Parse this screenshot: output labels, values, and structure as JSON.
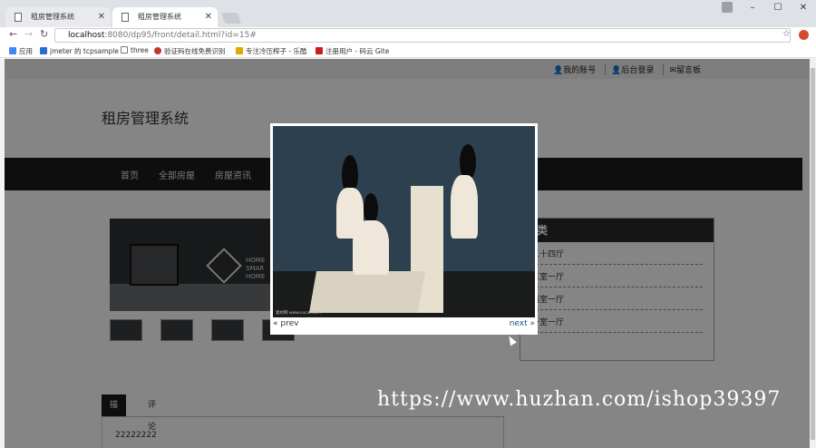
{
  "browser": {
    "tabs": [
      {
        "label": "租房管理系统"
      },
      {
        "label": "租房管理系统"
      }
    ],
    "address": {
      "host": "localhost",
      "rest": ":8080/dp95/front/detail.html?id=15#"
    },
    "bookmarks": [
      {
        "label": "应用",
        "color": "#4285f4"
      },
      {
        "label": "jmeter 的 tcpsample",
        "color": "#2a6dd2"
      },
      {
        "label": "three",
        "color": "#777777"
      },
      {
        "label": "验证码在线免费识别",
        "color": "#c0392b"
      },
      {
        "label": "专注冷压榨子 - 乐酷",
        "color": "#e0a800"
      },
      {
        "label": "注册用户 - 码云 Gite",
        "color": "#c71d23"
      }
    ]
  },
  "site": {
    "toplinks": [
      "我的账号",
      "后台登录",
      "留言板"
    ],
    "title": "租房管理系统",
    "nav": [
      "首页",
      "全部房屋",
      "房屋资讯"
    ],
    "gallery_text": [
      "HOME",
      "SMAR",
      "HOME"
    ],
    "sidebar": {
      "title": "分类",
      "items": [
        "三十四厅",
        "三室一厅",
        "两室一厅",
        "一室一厅"
      ]
    },
    "tabs": [
      "描述",
      "评论"
    ],
    "description": "22222222"
  },
  "lightbox": {
    "prev": "« prev",
    "next": "next »",
    "caption": "素材网 www.sucai.com"
  },
  "watermark": "https://www.huzhan.com/ishop39397"
}
